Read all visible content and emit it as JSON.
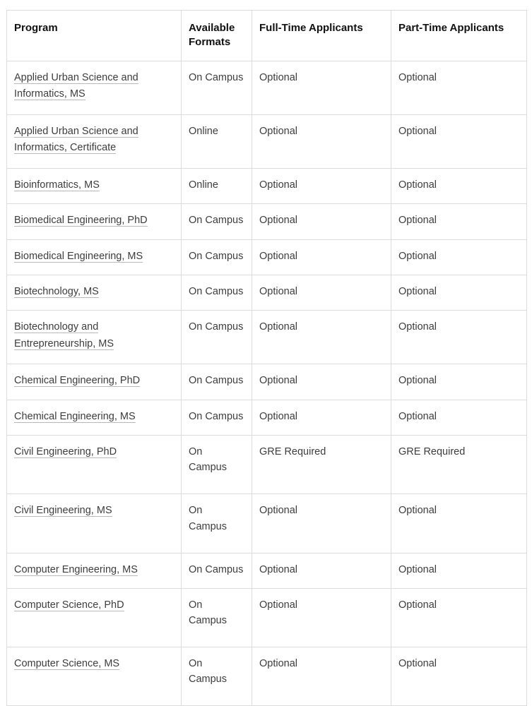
{
  "table": {
    "columns": [
      {
        "key": "program",
        "label": "Program"
      },
      {
        "key": "formats",
        "label": "Available Formats"
      },
      {
        "key": "fulltime",
        "label": "Full-Time Applicants"
      },
      {
        "key": "parttime",
        "label": "Part-Time Applicants"
      }
    ],
    "rows": [
      {
        "program": "Applied Urban Science and Informatics, MS",
        "formats": "On Campus",
        "fulltime": "Optional",
        "parttime": "Optional"
      },
      {
        "program": "Applied Urban Science and Informatics, Certificate",
        "formats": "Online",
        "fulltime": "Optional",
        "parttime": "Optional"
      },
      {
        "program": "Bioinformatics, MS",
        "formats": "Online",
        "fulltime": "Optional",
        "parttime": "Optional"
      },
      {
        "program": "Biomedical Engineering, PhD",
        "formats": "On Campus",
        "fulltime": "Optional",
        "parttime": "Optional"
      },
      {
        "program": "Biomedical Engineering, MS",
        "formats": "On Campus",
        "fulltime": "Optional",
        "parttime": "Optional"
      },
      {
        "program": "Biotechnology, MS",
        "formats": "On Campus",
        "fulltime": "Optional",
        "parttime": "Optional"
      },
      {
        "program": "Biotechnology and Entrepreneurship, MS",
        "formats": "On Campus",
        "fulltime": "Optional",
        "parttime": "Optional"
      },
      {
        "program": "Chemical Engineering, PhD",
        "formats": "On Campus",
        "fulltime": "Optional",
        "parttime": "Optional"
      },
      {
        "program": "Chemical Engineering, MS",
        "formats": "On Campus",
        "fulltime": "Optional",
        "parttime": "Optional"
      },
      {
        "program": "Civil Engineering, PhD",
        "formats": "On Campus",
        "fulltime": "GRE Required",
        "parttime": "GRE Required"
      },
      {
        "program": "Civil Engineering, MS",
        "formats": "On Campus",
        "fulltime": "Optional",
        "parttime": "Optional"
      },
      {
        "program": "Computer Engineering, MS",
        "formats": "On Campus",
        "fulltime": "Optional",
        "parttime": "Optional"
      },
      {
        "program": "Computer Science, PhD",
        "formats": "On Campus",
        "fulltime": "Optional",
        "parttime": "Optional"
      },
      {
        "program": "Computer Science, MS",
        "formats": "On Campus",
        "fulltime": "Optional",
        "parttime": "Optional"
      }
    ]
  },
  "style": {
    "border_color": "#dcdcdc",
    "header_text_color": "#111111",
    "body_text_color": "#3d3d3d",
    "link_underline_color": "#b9b9b9",
    "background": "#ffffff"
  }
}
